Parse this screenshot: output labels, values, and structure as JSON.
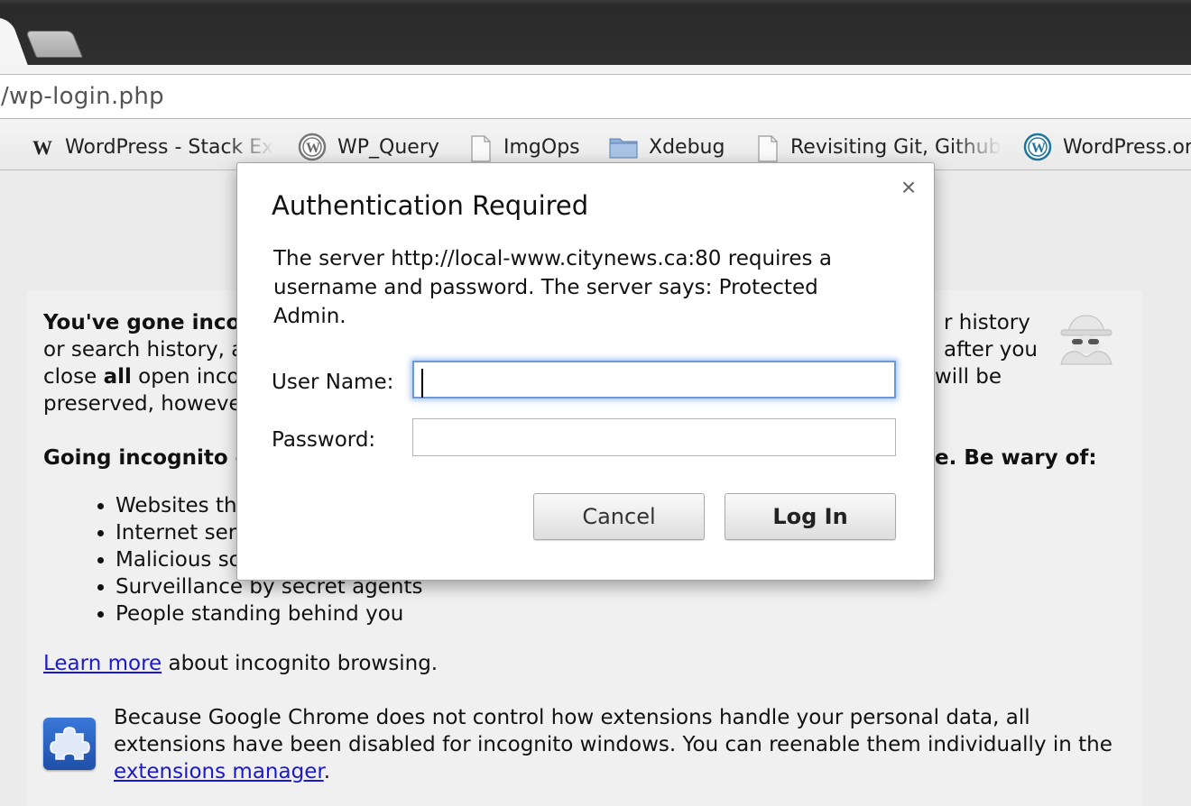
{
  "browser": {
    "url": "/wp-login.php",
    "bookmarks": [
      {
        "label": "WordPress - Stack Ex",
        "icon": "w-icon"
      },
      {
        "label": "WP_Query",
        "icon": "wordpress-icon"
      },
      {
        "label": "ImgOps",
        "icon": "page-icon"
      },
      {
        "label": "Xdebug",
        "icon": "folder-icon"
      },
      {
        "label": "Revisiting Git, Github",
        "icon": "page-icon"
      },
      {
        "label": "WordPress.or",
        "icon": "wordpress-icon"
      }
    ]
  },
  "incognito": {
    "intro": {
      "line1_bold": "You've gone incog",
      "line1_tail": "r history",
      "line2": "or search history, a",
      "line2_tail": "after you",
      "line3_pre": "close ",
      "line3_bold": "all",
      "line3_post": " open inco",
      "line3_tail": "will be",
      "line4": "preserved, howeve"
    },
    "wary_heading_start": "Going incognito d",
    "wary_heading_end": "e. Be wary of:",
    "wary_items": [
      "Websites th",
      "Internet ser",
      "Malicious so",
      "Surveillance by secret agents",
      "People standing behind you"
    ],
    "learn_more_link": "Learn more",
    "learn_more_tail": " about incognito browsing.",
    "extensions_line1": "Because Google Chrome does not control how extensions handle your personal data, all",
    "extensions_line2": "extensions have been disabled for incognito windows. You can reenable them individually in the",
    "extensions_link": "extensions manager",
    "extensions_period": "."
  },
  "dialog": {
    "title": "Authentication Required",
    "close_glyph": "×",
    "message": "The server http://local-www.citynews.ca:80 requires a username and password. The server says: Protected Admin.",
    "username_label": "User Name:",
    "username_value": "",
    "password_label": "Password:",
    "password_value": "",
    "cancel_label": "Cancel",
    "login_label": "Log In"
  }
}
